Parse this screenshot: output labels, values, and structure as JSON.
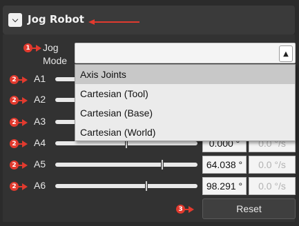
{
  "header": {
    "title": "Jog Robot",
    "collapse_icon": "chevron-down"
  },
  "callouts": {
    "mode": "1",
    "axes": "2",
    "reset": "3"
  },
  "jog_mode": {
    "label_line1": "Jog",
    "label_line2": "Mode",
    "value": "",
    "options": [
      "Axis Joints",
      "Cartesian (Tool)",
      "Cartesian (Base)",
      "Cartesian (World)"
    ],
    "highlighted": "Axis Joints"
  },
  "axes": [
    {
      "label": "A1",
      "angle": "",
      "speed": ""
    },
    {
      "label": "A2",
      "angle": "",
      "speed": ""
    },
    {
      "label": "A3",
      "angle": "",
      "speed": ""
    },
    {
      "label": "A4",
      "angle": "0.000 °",
      "speed": "0.0 °/s",
      "level": 0.5
    },
    {
      "label": "A5",
      "angle": "64.038 °",
      "speed": "0.0 °/s",
      "level": 0.75
    },
    {
      "label": "A6",
      "angle": "98.291 °",
      "speed": "0.0 °/s",
      "level": 0.64
    }
  ],
  "reset_label": "Reset",
  "colors": {
    "callout": "#e23a2e",
    "background": "#2b2b2b"
  }
}
